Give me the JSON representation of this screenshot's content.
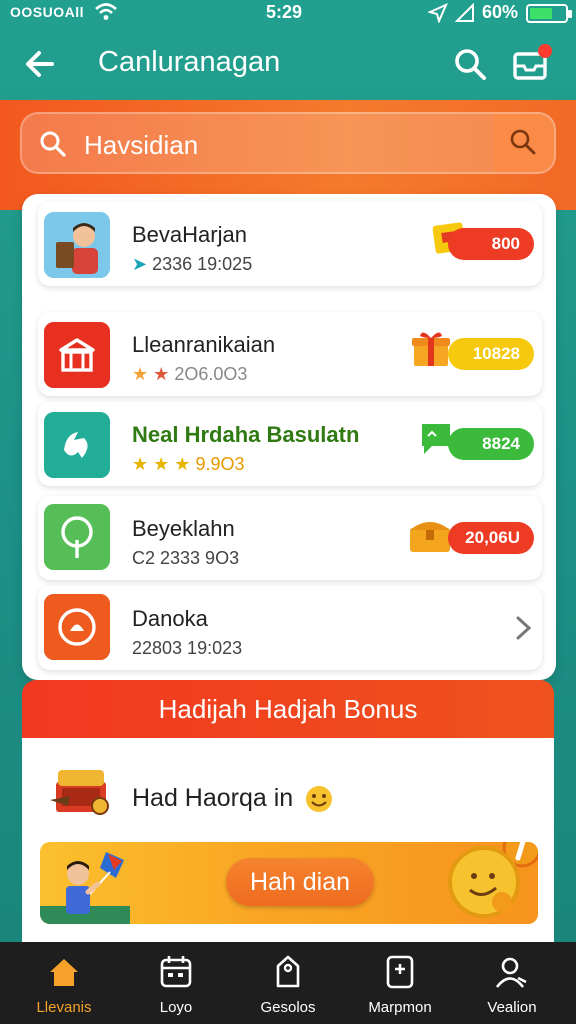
{
  "status_bar": {
    "carrier": "OOSUOAll",
    "time": "5:29",
    "battery_percent": "60%",
    "battery_level": 0.6
  },
  "app_bar": {
    "title": "Canluranagan",
    "back_icon": "arrow-left-icon",
    "search_icon": "search-icon",
    "inbox_icon": "inbox-icon"
  },
  "search": {
    "value": "Havsidian"
  },
  "list": {
    "items": [
      {
        "name": "BevaHarjan",
        "meta": "2336 19:025",
        "reward": "800",
        "icon": "reading-boy-avatar",
        "reward_color": "#ee3b24"
      },
      {
        "name": "Lleanranikaian",
        "meta": "2O6.0O3",
        "reward": "10828",
        "icon": "shop-icon",
        "reward_color": "#f6c90e"
      },
      {
        "name": "Neal Hrdaha Basulatn",
        "meta": "9.9O3",
        "reward": "8824",
        "icon": "gift-app-icon",
        "reward_color": "#3cba3c"
      },
      {
        "name": "Beyeklahn",
        "meta": "C2 2333 9O3",
        "reward": "20,06U",
        "icon": "tree-icon",
        "reward_color": "#ee3b24"
      },
      {
        "name": "Danoka",
        "meta": "22803 19:023",
        "reward": "",
        "icon": "ring-icon",
        "reward_color": ""
      }
    ]
  },
  "bonus": {
    "header": "Hadijah Hadjah Bonus",
    "headline": "Had Haorqa in",
    "cta": "Hah dian"
  },
  "bottom_nav": {
    "items": [
      {
        "label": "Llevanis",
        "icon": "home-icon",
        "active": true
      },
      {
        "label": "Loyo",
        "icon": "calendar-icon",
        "active": false
      },
      {
        "label": "Gesolos",
        "icon": "tag-icon",
        "active": false
      },
      {
        "label": "Marpmon",
        "icon": "wallet-icon",
        "active": false
      },
      {
        "label": "Vealion",
        "icon": "profile-icon",
        "active": false
      }
    ]
  },
  "colors": {
    "teal": "#1f9c8c",
    "orange": "#f2581e",
    "red": "#ee3b24",
    "yellow": "#f6c90e",
    "green": "#3cba3c",
    "active_nav": "#f6a12a"
  }
}
